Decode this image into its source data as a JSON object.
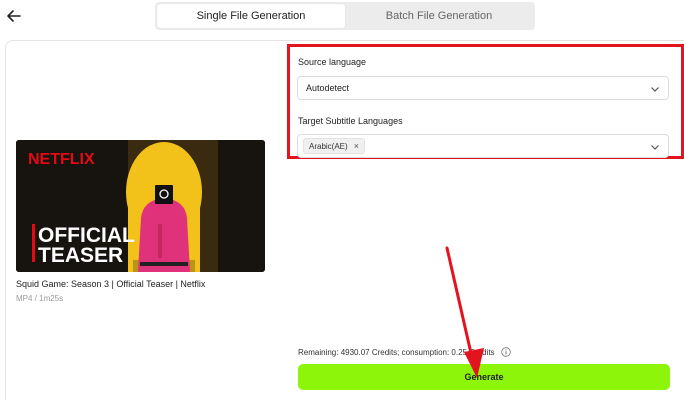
{
  "tabs": [
    {
      "label": "Single File Generation",
      "active": true
    },
    {
      "label": "Batch File Generation",
      "active": false
    }
  ],
  "icons": {
    "back": "arrow-left-icon",
    "chevron": "chevron-down-icon",
    "info": "info-icon",
    "remove": "close-icon"
  },
  "video": {
    "thumbnail": {
      "brand": "NETFLIX",
      "line1": "OFFICIAL",
      "line2": "TEASER"
    },
    "title": "Squid Game: Season 3 | Official Teaser | Netflix",
    "meta": "MP4 / 1m25s"
  },
  "form": {
    "source_label": "Source language",
    "source_value": "Autodetect",
    "target_label": "Target Subtitle Languages",
    "target_chips": [
      "Arabic(AE)"
    ]
  },
  "footer": {
    "remaining_text": "Remaining: 4930.07 Credits; consumption: 0.25 Credits",
    "generate_label": "Generate"
  },
  "colors": {
    "accent": "#8cf50a",
    "highlight": "#e4141f",
    "netflix": "#e50914",
    "pink": "#e0327a"
  }
}
